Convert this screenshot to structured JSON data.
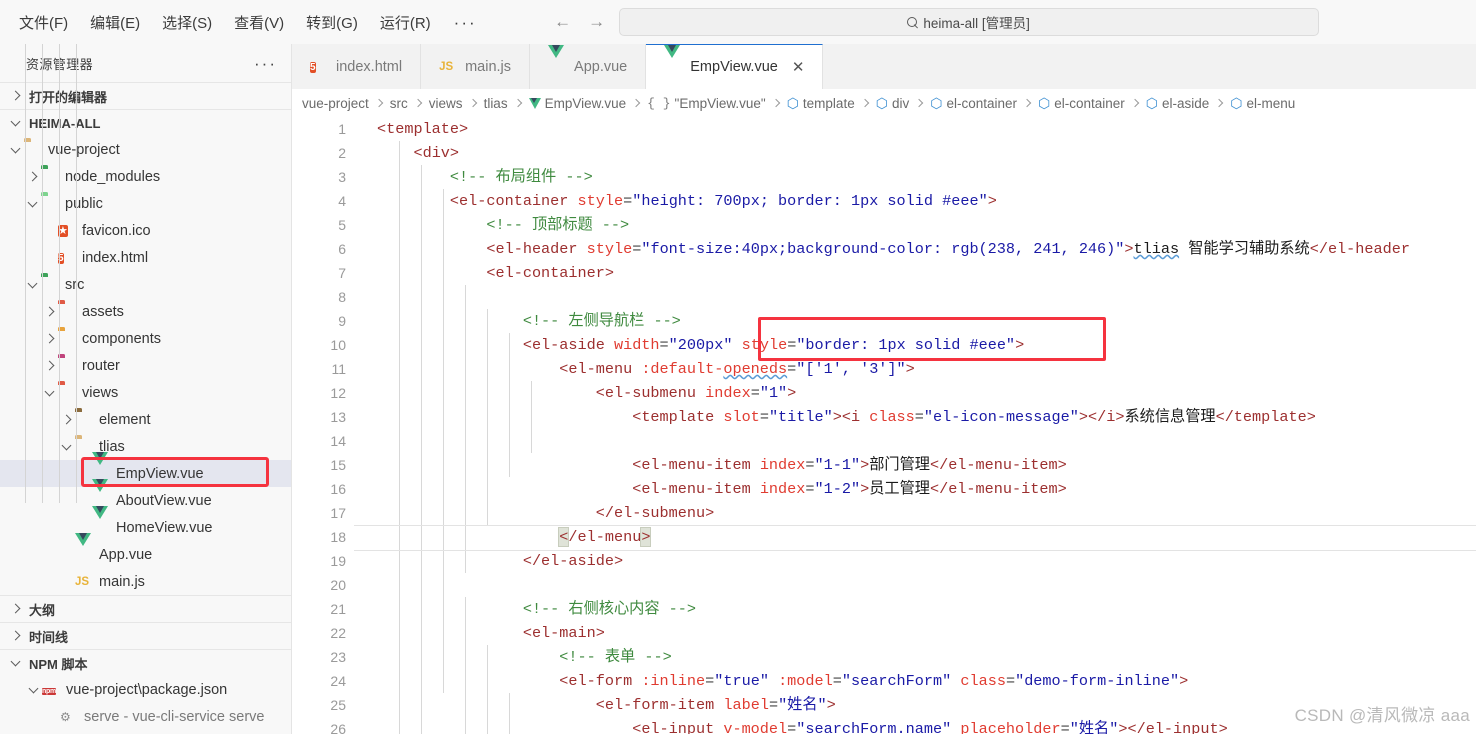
{
  "titlebar": {
    "menus": [
      "文件(F)",
      "编辑(E)",
      "选择(S)",
      "查看(V)",
      "转到(G)",
      "运行(R)"
    ],
    "more": "···",
    "back_icon": "←",
    "forward_icon": "→",
    "search_value": "heima-all [管理员]",
    "search_icon": "search-icon"
  },
  "sidebar": {
    "title": "资源管理器",
    "more": "···",
    "open_editors": "打开的编辑器",
    "root": "HEIMA-ALL",
    "tree": [
      {
        "label": "vue-project",
        "indent": 1,
        "icon": "folder-tan",
        "twisty": "open"
      },
      {
        "label": "node_modules",
        "indent": 2,
        "icon": "folder-green",
        "twisty": "closed"
      },
      {
        "label": "public",
        "indent": 2,
        "icon": "folder-greenlt",
        "twisty": "open"
      },
      {
        "label": "favicon.ico",
        "indent": 3,
        "icon": "star",
        "twisty": "none"
      },
      {
        "label": "index.html",
        "indent": 3,
        "icon": "html5",
        "twisty": "none"
      },
      {
        "label": "src",
        "indent": 2,
        "icon": "folder-green",
        "twisty": "open"
      },
      {
        "label": "assets",
        "indent": 3,
        "icon": "folder-red",
        "twisty": "closed"
      },
      {
        "label": "components",
        "indent": 3,
        "icon": "folder-orange",
        "twisty": "closed"
      },
      {
        "label": "router",
        "indent": 3,
        "icon": "folder-magenta",
        "twisty": "closed"
      },
      {
        "label": "views",
        "indent": 3,
        "icon": "folder-red",
        "twisty": "open"
      },
      {
        "label": "element",
        "indent": 4,
        "icon": "folder-dark",
        "twisty": "closed"
      },
      {
        "label": "tlias",
        "indent": 4,
        "icon": "folder-tan",
        "twisty": "open"
      },
      {
        "label": "EmpView.vue",
        "indent": 5,
        "icon": "vue",
        "twisty": "none",
        "selected": true
      },
      {
        "label": "AboutView.vue",
        "indent": 5,
        "icon": "vue",
        "twisty": "none"
      },
      {
        "label": "HomeView.vue",
        "indent": 5,
        "icon": "vue",
        "twisty": "none"
      },
      {
        "label": "App.vue",
        "indent": 4,
        "icon": "vue",
        "twisty": "none"
      },
      {
        "label": "main.js",
        "indent": 4,
        "icon": "js",
        "twisty": "none"
      }
    ],
    "outline": "大纲",
    "timeline": "时间线",
    "npm_scripts": "NPM 脚本",
    "npm_package": "vue-project\\package.json",
    "npm_script_partial": "serve - vue-cli-service serve"
  },
  "tabs": [
    {
      "label": "index.html",
      "icon": "html5",
      "active": false,
      "closable": false
    },
    {
      "label": "main.js",
      "icon": "js",
      "active": false,
      "closable": false
    },
    {
      "label": "App.vue",
      "icon": "vue",
      "active": false,
      "closable": false
    },
    {
      "label": "EmpView.vue",
      "icon": "vue",
      "active": true,
      "closable": true,
      "close": "✕"
    }
  ],
  "breadcrumb": [
    {
      "label": "vue-project",
      "icon": "none"
    },
    {
      "label": "src",
      "icon": "none"
    },
    {
      "label": "views",
      "icon": "none"
    },
    {
      "label": "tlias",
      "icon": "none"
    },
    {
      "label": "EmpView.vue",
      "icon": "vue"
    },
    {
      "label": "\"EmpView.vue\"",
      "icon": "brace"
    },
    {
      "label": "template",
      "icon": "cube"
    },
    {
      "label": "div",
      "icon": "cube"
    },
    {
      "label": "el-container",
      "icon": "cube"
    },
    {
      "label": "el-container",
      "icon": "cube"
    },
    {
      "label": "el-aside",
      "icon": "cube"
    },
    {
      "label": "el-menu",
      "icon": "cube"
    }
  ],
  "code": {
    "first_line": 1,
    "last_line": 26,
    "current_line": 18,
    "lines": [
      {
        "n": 1,
        "segs": [
          {
            "t": "tag",
            "s": "<template>"
          }
        ]
      },
      {
        "n": 2,
        "segs": [
          {
            "t": "plain",
            "s": "    "
          },
          {
            "t": "tag",
            "s": "<div>"
          }
        ]
      },
      {
        "n": 3,
        "segs": [
          {
            "t": "plain",
            "s": "        "
          },
          {
            "t": "cmt",
            "s": "<!-- 布局组件 -->"
          }
        ]
      },
      {
        "n": 4,
        "segs": [
          {
            "t": "plain",
            "s": "        "
          },
          {
            "t": "tag",
            "s": "<el-container "
          },
          {
            "t": "attr",
            "s": "style"
          },
          {
            "t": "punct",
            "s": "="
          },
          {
            "t": "str",
            "s": "\"height: 700px; border: 1px solid #eee\""
          },
          {
            "t": "tag",
            "s": ">"
          }
        ]
      },
      {
        "n": 5,
        "segs": [
          {
            "t": "plain",
            "s": "            "
          },
          {
            "t": "cmt",
            "s": "<!-- 顶部标题 -->"
          }
        ]
      },
      {
        "n": 6,
        "segs": [
          {
            "t": "plain",
            "s": "            "
          },
          {
            "t": "tag",
            "s": "<el-header "
          },
          {
            "t": "attr",
            "s": "style"
          },
          {
            "t": "punct",
            "s": "="
          },
          {
            "t": "str",
            "s": "\"font-size:40px;background-color: rgb(238, 241, 246)\""
          },
          {
            "t": "tag",
            "s": ">"
          },
          {
            "t": "squig",
            "s": "tlias"
          },
          {
            "t": "txt",
            "s": " 智能学习辅助系统"
          },
          {
            "t": "tag",
            "s": "</el-header"
          }
        ]
      },
      {
        "n": 7,
        "segs": [
          {
            "t": "plain",
            "s": "            "
          },
          {
            "t": "tag",
            "s": "<el-container>"
          }
        ]
      },
      {
        "n": 8,
        "segs": []
      },
      {
        "n": 9,
        "segs": [
          {
            "t": "plain",
            "s": "                "
          },
          {
            "t": "cmt",
            "s": "<!-- 左侧导航栏 -->"
          }
        ]
      },
      {
        "n": 10,
        "segs": [
          {
            "t": "plain",
            "s": "                "
          },
          {
            "t": "tag",
            "s": "<el-aside "
          },
          {
            "t": "attr",
            "s": "width"
          },
          {
            "t": "punct",
            "s": "="
          },
          {
            "t": "str",
            "s": "\"200px\""
          },
          {
            "t": "plain",
            "s": " "
          },
          {
            "t": "attr",
            "s": "style"
          },
          {
            "t": "punct",
            "s": "="
          },
          {
            "t": "str",
            "s": "\"border: 1px solid #eee\""
          },
          {
            "t": "tag",
            "s": ">"
          }
        ]
      },
      {
        "n": 11,
        "segs": [
          {
            "t": "plain",
            "s": "                    "
          },
          {
            "t": "tag",
            "s": "<el-menu "
          },
          {
            "t": "attr",
            "s": ":default-"
          },
          {
            "t": "attrsquig",
            "s": "openeds"
          },
          {
            "t": "punct",
            "s": "="
          },
          {
            "t": "str",
            "s": "\"['1', '3']\""
          },
          {
            "t": "tag",
            "s": ">"
          }
        ]
      },
      {
        "n": 12,
        "segs": [
          {
            "t": "plain",
            "s": "                        "
          },
          {
            "t": "tag",
            "s": "<el-submenu "
          },
          {
            "t": "attr",
            "s": "index"
          },
          {
            "t": "punct",
            "s": "="
          },
          {
            "t": "str",
            "s": "\"1\""
          },
          {
            "t": "tag",
            "s": ">"
          }
        ]
      },
      {
        "n": 13,
        "segs": [
          {
            "t": "plain",
            "s": "                            "
          },
          {
            "t": "tag",
            "s": "<template "
          },
          {
            "t": "attr",
            "s": "slot"
          },
          {
            "t": "punct",
            "s": "="
          },
          {
            "t": "str",
            "s": "\"title\""
          },
          {
            "t": "tag",
            "s": "><i "
          },
          {
            "t": "attr",
            "s": "class"
          },
          {
            "t": "punct",
            "s": "="
          },
          {
            "t": "str",
            "s": "\"el-icon-message\""
          },
          {
            "t": "tag",
            "s": "></i>"
          },
          {
            "t": "txt",
            "s": "系统信息管理"
          },
          {
            "t": "tag",
            "s": "</template>"
          }
        ]
      },
      {
        "n": 14,
        "segs": []
      },
      {
        "n": 15,
        "segs": [
          {
            "t": "plain",
            "s": "                            "
          },
          {
            "t": "tag",
            "s": "<el-menu-item "
          },
          {
            "t": "attr",
            "s": "index"
          },
          {
            "t": "punct",
            "s": "="
          },
          {
            "t": "str",
            "s": "\"1-1\""
          },
          {
            "t": "tag",
            "s": ">"
          },
          {
            "t": "txt",
            "s": "部门管理"
          },
          {
            "t": "tag",
            "s": "</el-menu-item>"
          }
        ]
      },
      {
        "n": 16,
        "segs": [
          {
            "t": "plain",
            "s": "                            "
          },
          {
            "t": "tag",
            "s": "<el-menu-item "
          },
          {
            "t": "attr",
            "s": "index"
          },
          {
            "t": "punct",
            "s": "="
          },
          {
            "t": "str",
            "s": "\"1-2\""
          },
          {
            "t": "tag",
            "s": ">"
          },
          {
            "t": "txt",
            "s": "员工管理"
          },
          {
            "t": "tag",
            "s": "</el-menu-item>"
          }
        ]
      },
      {
        "n": 17,
        "segs": [
          {
            "t": "plain",
            "s": "                        "
          },
          {
            "t": "tag",
            "s": "</el-submenu>"
          }
        ]
      },
      {
        "n": 18,
        "segs": [
          {
            "t": "plain",
            "s": "                    "
          },
          {
            "t": "bmatch",
            "s": "<"
          },
          {
            "t": "tag",
            "s": "/el-menu"
          },
          {
            "t": "bmatch",
            "s": ">"
          }
        ]
      },
      {
        "n": 19,
        "segs": [
          {
            "t": "plain",
            "s": "                "
          },
          {
            "t": "tag",
            "s": "</el-aside>"
          }
        ]
      },
      {
        "n": 20,
        "segs": []
      },
      {
        "n": 21,
        "segs": [
          {
            "t": "plain",
            "s": "                "
          },
          {
            "t": "cmt",
            "s": "<!-- 右侧核心内容 -->"
          }
        ]
      },
      {
        "n": 22,
        "segs": [
          {
            "t": "plain",
            "s": "                "
          },
          {
            "t": "tag",
            "s": "<el-main>"
          }
        ]
      },
      {
        "n": 23,
        "segs": [
          {
            "t": "plain",
            "s": "                    "
          },
          {
            "t": "cmt",
            "s": "<!-- 表单 -->"
          }
        ]
      },
      {
        "n": 24,
        "segs": [
          {
            "t": "plain",
            "s": "                    "
          },
          {
            "t": "tag",
            "s": "<el-form "
          },
          {
            "t": "attr",
            "s": ":inline"
          },
          {
            "t": "punct",
            "s": "="
          },
          {
            "t": "str",
            "s": "\"true\""
          },
          {
            "t": "plain",
            "s": " "
          },
          {
            "t": "attr",
            "s": ":model"
          },
          {
            "t": "punct",
            "s": "="
          },
          {
            "t": "str",
            "s": "\"searchForm\""
          },
          {
            "t": "plain",
            "s": " "
          },
          {
            "t": "attr",
            "s": "class"
          },
          {
            "t": "punct",
            "s": "="
          },
          {
            "t": "str",
            "s": "\"demo-form-inline\""
          },
          {
            "t": "tag",
            "s": ">"
          }
        ]
      },
      {
        "n": 25,
        "segs": [
          {
            "t": "plain",
            "s": "                        "
          },
          {
            "t": "tag",
            "s": "<el-form-item "
          },
          {
            "t": "attr",
            "s": "label"
          },
          {
            "t": "punct",
            "s": "="
          },
          {
            "t": "str",
            "s": "\"姓名\""
          },
          {
            "t": "tag",
            "s": ">"
          }
        ]
      },
      {
        "n": 26,
        "segs": [
          {
            "t": "plain",
            "s": "                            "
          },
          {
            "t": "tag",
            "s": "<el-input "
          },
          {
            "t": "attr",
            "s": "v-model"
          },
          {
            "t": "punct",
            "s": "="
          },
          {
            "t": "str",
            "s": "\"searchForm.name\""
          },
          {
            "t": "plain",
            "s": " "
          },
          {
            "t": "attr",
            "s": "placeholder"
          },
          {
            "t": "punct",
            "s": "="
          },
          {
            "t": "str",
            "s": "\"姓名\""
          },
          {
            "t": "tag",
            "s": "></el-input>"
          }
        ]
      }
    ]
  },
  "annotations": {
    "color": "#f5333f",
    "file_highlight": "EmpView.vue",
    "code_highlight": "style=\"border: 1px solid #eee\""
  },
  "watermark": "CSDN @清风微凉 aaa"
}
